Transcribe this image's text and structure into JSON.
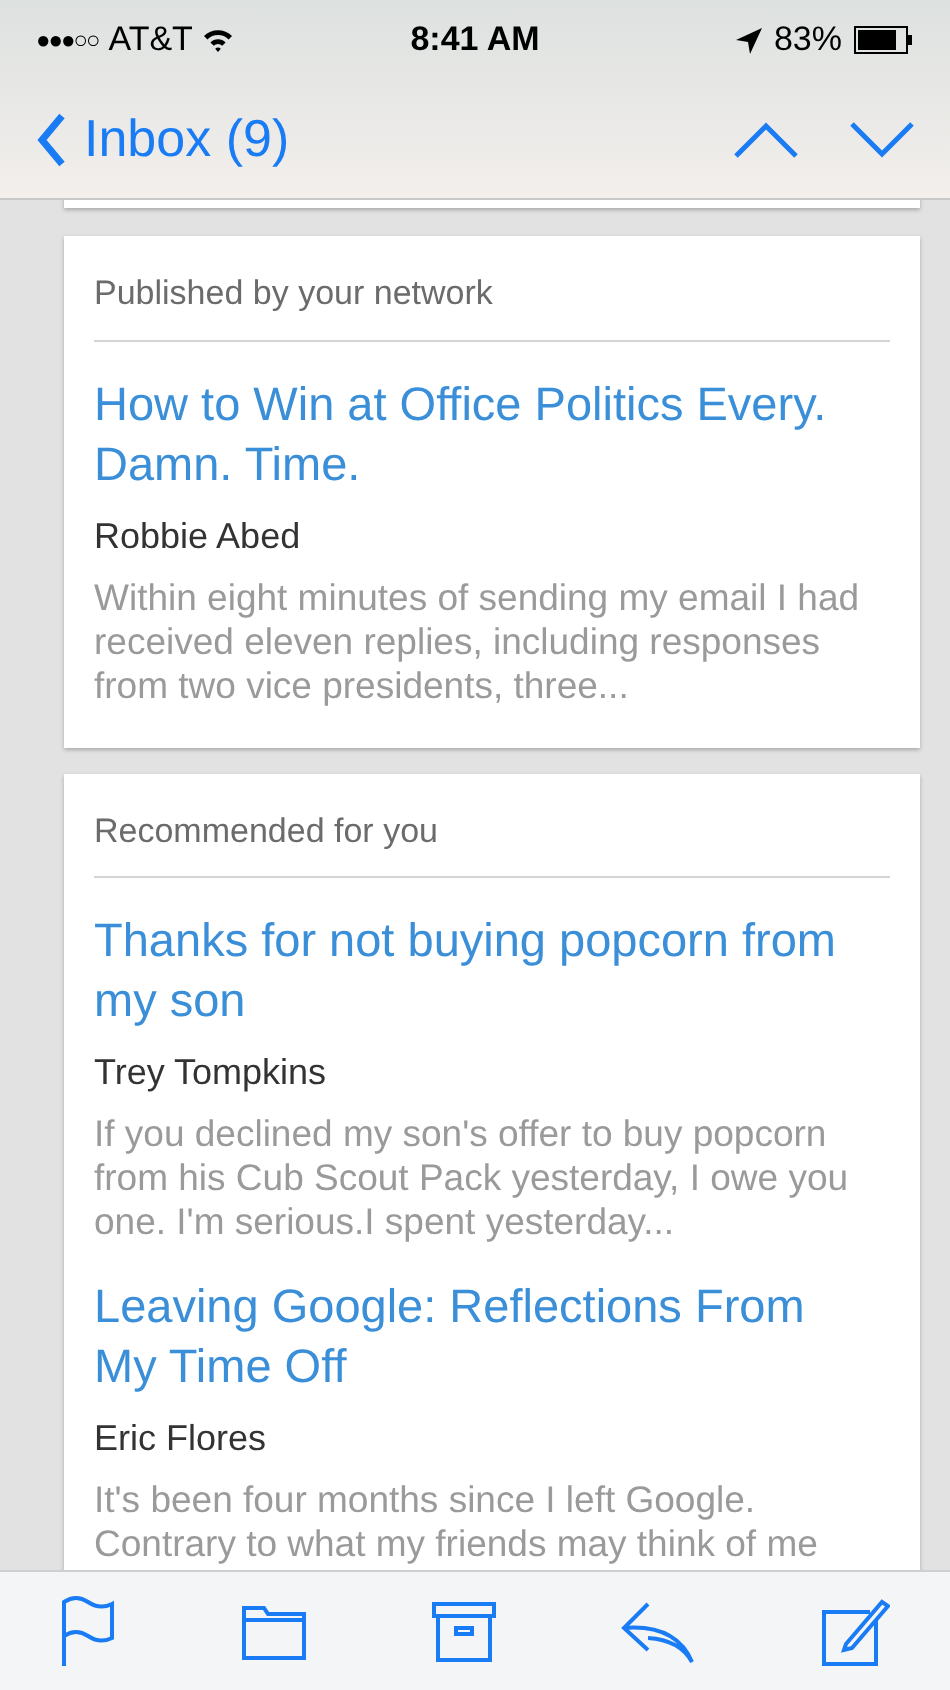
{
  "status_bar": {
    "signal_dots": "●●●○○",
    "carrier": "AT&T",
    "time": "8:41 AM",
    "battery": "83%"
  },
  "nav_bar": {
    "back_label": "Inbox (9)"
  },
  "cards": [
    {
      "header": "Published by your network",
      "articles": [
        {
          "title": "How to Win at Office Politics Every. Damn. Time.",
          "author": "Robbie Abed",
          "snippet": "Within eight minutes of sending my email I had received eleven replies, including responses from two vice presidents, three..."
        }
      ]
    },
    {
      "header": "Recommended for you",
      "articles": [
        {
          "title": "Thanks for not buying popcorn from my son",
          "author": "Trey Tompkins",
          "snippet": "If you declined my son's offer to buy popcorn from his Cub Scout Pack yesterday, I owe you one. I'm serious.I spent yesterday..."
        },
        {
          "title": "Leaving Google: Reflections From My Time Off",
          "author": "Eric Flores",
          "snippet": "It's been four months since I left Google. Contrary to what my friends may think of me"
        }
      ]
    }
  ]
}
